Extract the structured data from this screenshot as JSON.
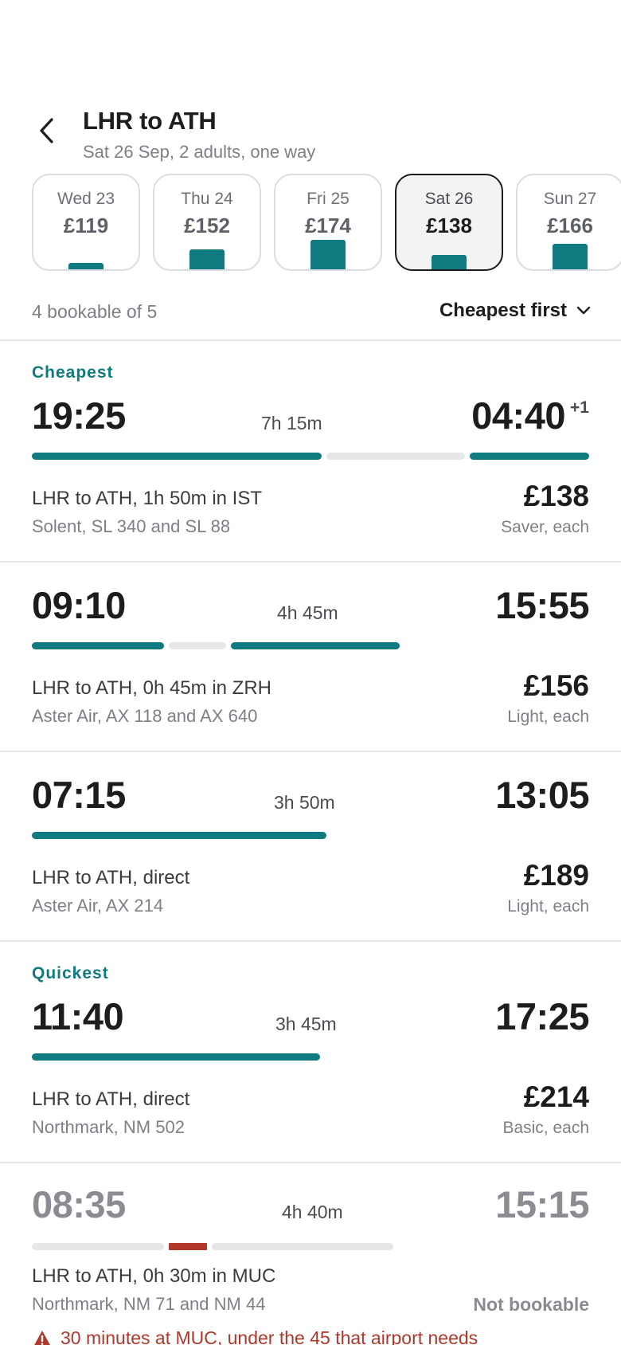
{
  "header": {
    "title": "LHR to ATH",
    "subtitle": "Sat 26 Sep, 2 adults, one way"
  },
  "dates": [
    {
      "day": "Wed 23",
      "price": "£119",
      "level": 0.12
    },
    {
      "day": "Thu 24",
      "price": "£152",
      "level": 0.62
    },
    {
      "day": "Fri 25",
      "price": "£174",
      "level": 0.97
    },
    {
      "day": "Sat 26",
      "price": "£138",
      "level": 0.42,
      "selected": true
    },
    {
      "day": "Sun 27",
      "price": "£166",
      "level": 0.82
    }
  ],
  "list": {
    "count": "4 bookable of 5",
    "sort_label": "Cheapest first"
  },
  "flights": [
    {
      "tag": "Cheapest",
      "depart": "19:25",
      "arrive": "04:40",
      "plus_day": "+1",
      "duration": "7h 15m",
      "route": "LHR to ATH, 1h 50m in IST",
      "carrier": "Solent, SL 340 and SL 88",
      "price": "£138",
      "fare": "Saver, each"
    },
    {
      "depart": "09:10",
      "arrive": "15:55",
      "duration": "4h 45m",
      "route": "LHR to ATH, 0h 45m in ZRH",
      "carrier": "Aster Air, AX 118 and AX 640",
      "price": "£156",
      "fare": "Light, each"
    },
    {
      "depart": "07:15",
      "arrive": "13:05",
      "duration": "3h 50m",
      "route": "LHR to ATH, direct",
      "carrier": "Aster Air, AX 214",
      "price": "£189",
      "fare": "Light, each"
    },
    {
      "tag": "Quickest",
      "depart": "11:40",
      "arrive": "17:25",
      "duration": "3h 45m",
      "route": "LHR to ATH, direct",
      "carrier": "Northmark, NM 502",
      "price": "£214",
      "fare": "Basic, each"
    },
    {
      "depart": "08:35",
      "arrive": "15:15",
      "duration": "4h 40m",
      "route": "LHR to ATH, 0h 30m in MUC",
      "carrier": "Northmark, NM 71 and NM 44",
      "status": "Not bookable",
      "warning": "30 minutes at MUC, under the 45 that airport needs"
    }
  ],
  "colors": {
    "accent": "#0f7b80",
    "warning": "#b1372a",
    "muted": "#7d8087"
  }
}
